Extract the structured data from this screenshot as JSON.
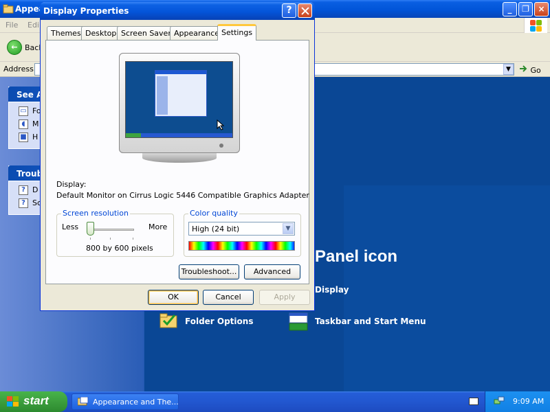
{
  "background_window": {
    "title": "Appea",
    "menu": [
      "File",
      "Edi"
    ],
    "toolbar": {
      "back_label": "Back"
    },
    "address": {
      "label": "Address",
      "go_label": "Go"
    },
    "task_panes": [
      {
        "header": "See A",
        "items": [
          "Fo",
          "M",
          "H"
        ]
      },
      {
        "header": "Troub",
        "items": [
          "D",
          "Sc"
        ]
      }
    ],
    "heading": "Panel icon",
    "links": {
      "display": "Display",
      "folder_options": "Folder Options",
      "taskbar_start": "Taskbar and Start Menu"
    }
  },
  "dialog": {
    "title": "Display Properties",
    "help_label": "?",
    "tabs": [
      {
        "label": "Themes"
      },
      {
        "label": "Desktop"
      },
      {
        "label": "Screen Saver"
      },
      {
        "label": "Appearance"
      },
      {
        "label": "Settings"
      }
    ],
    "active_tab": "Settings",
    "display_label": "Display:",
    "display_value": "Default Monitor on Cirrus Logic 5446 Compatible Graphics Adapter",
    "resolution": {
      "legend": "Screen resolution",
      "less": "Less",
      "more": "More",
      "value": "800 by 600 pixels",
      "slider_position": 0
    },
    "color_quality": {
      "legend": "Color quality",
      "selected": "High (24 bit)"
    },
    "buttons": {
      "troubleshoot": "Troubleshoot...",
      "advanced": "Advanced",
      "ok": "OK",
      "cancel": "Cancel",
      "apply": "Apply"
    }
  },
  "taskbar": {
    "start_label": "start",
    "task_item": "Appearance and The...",
    "clock": "9:09 AM"
  },
  "colors": {
    "titlebar_blue": "#0454d9",
    "taskbar_blue": "#2257d0",
    "start_green": "#3c9e3d",
    "dialog_face": "#ece9d8",
    "groupbox_legend": "#0046d5"
  }
}
